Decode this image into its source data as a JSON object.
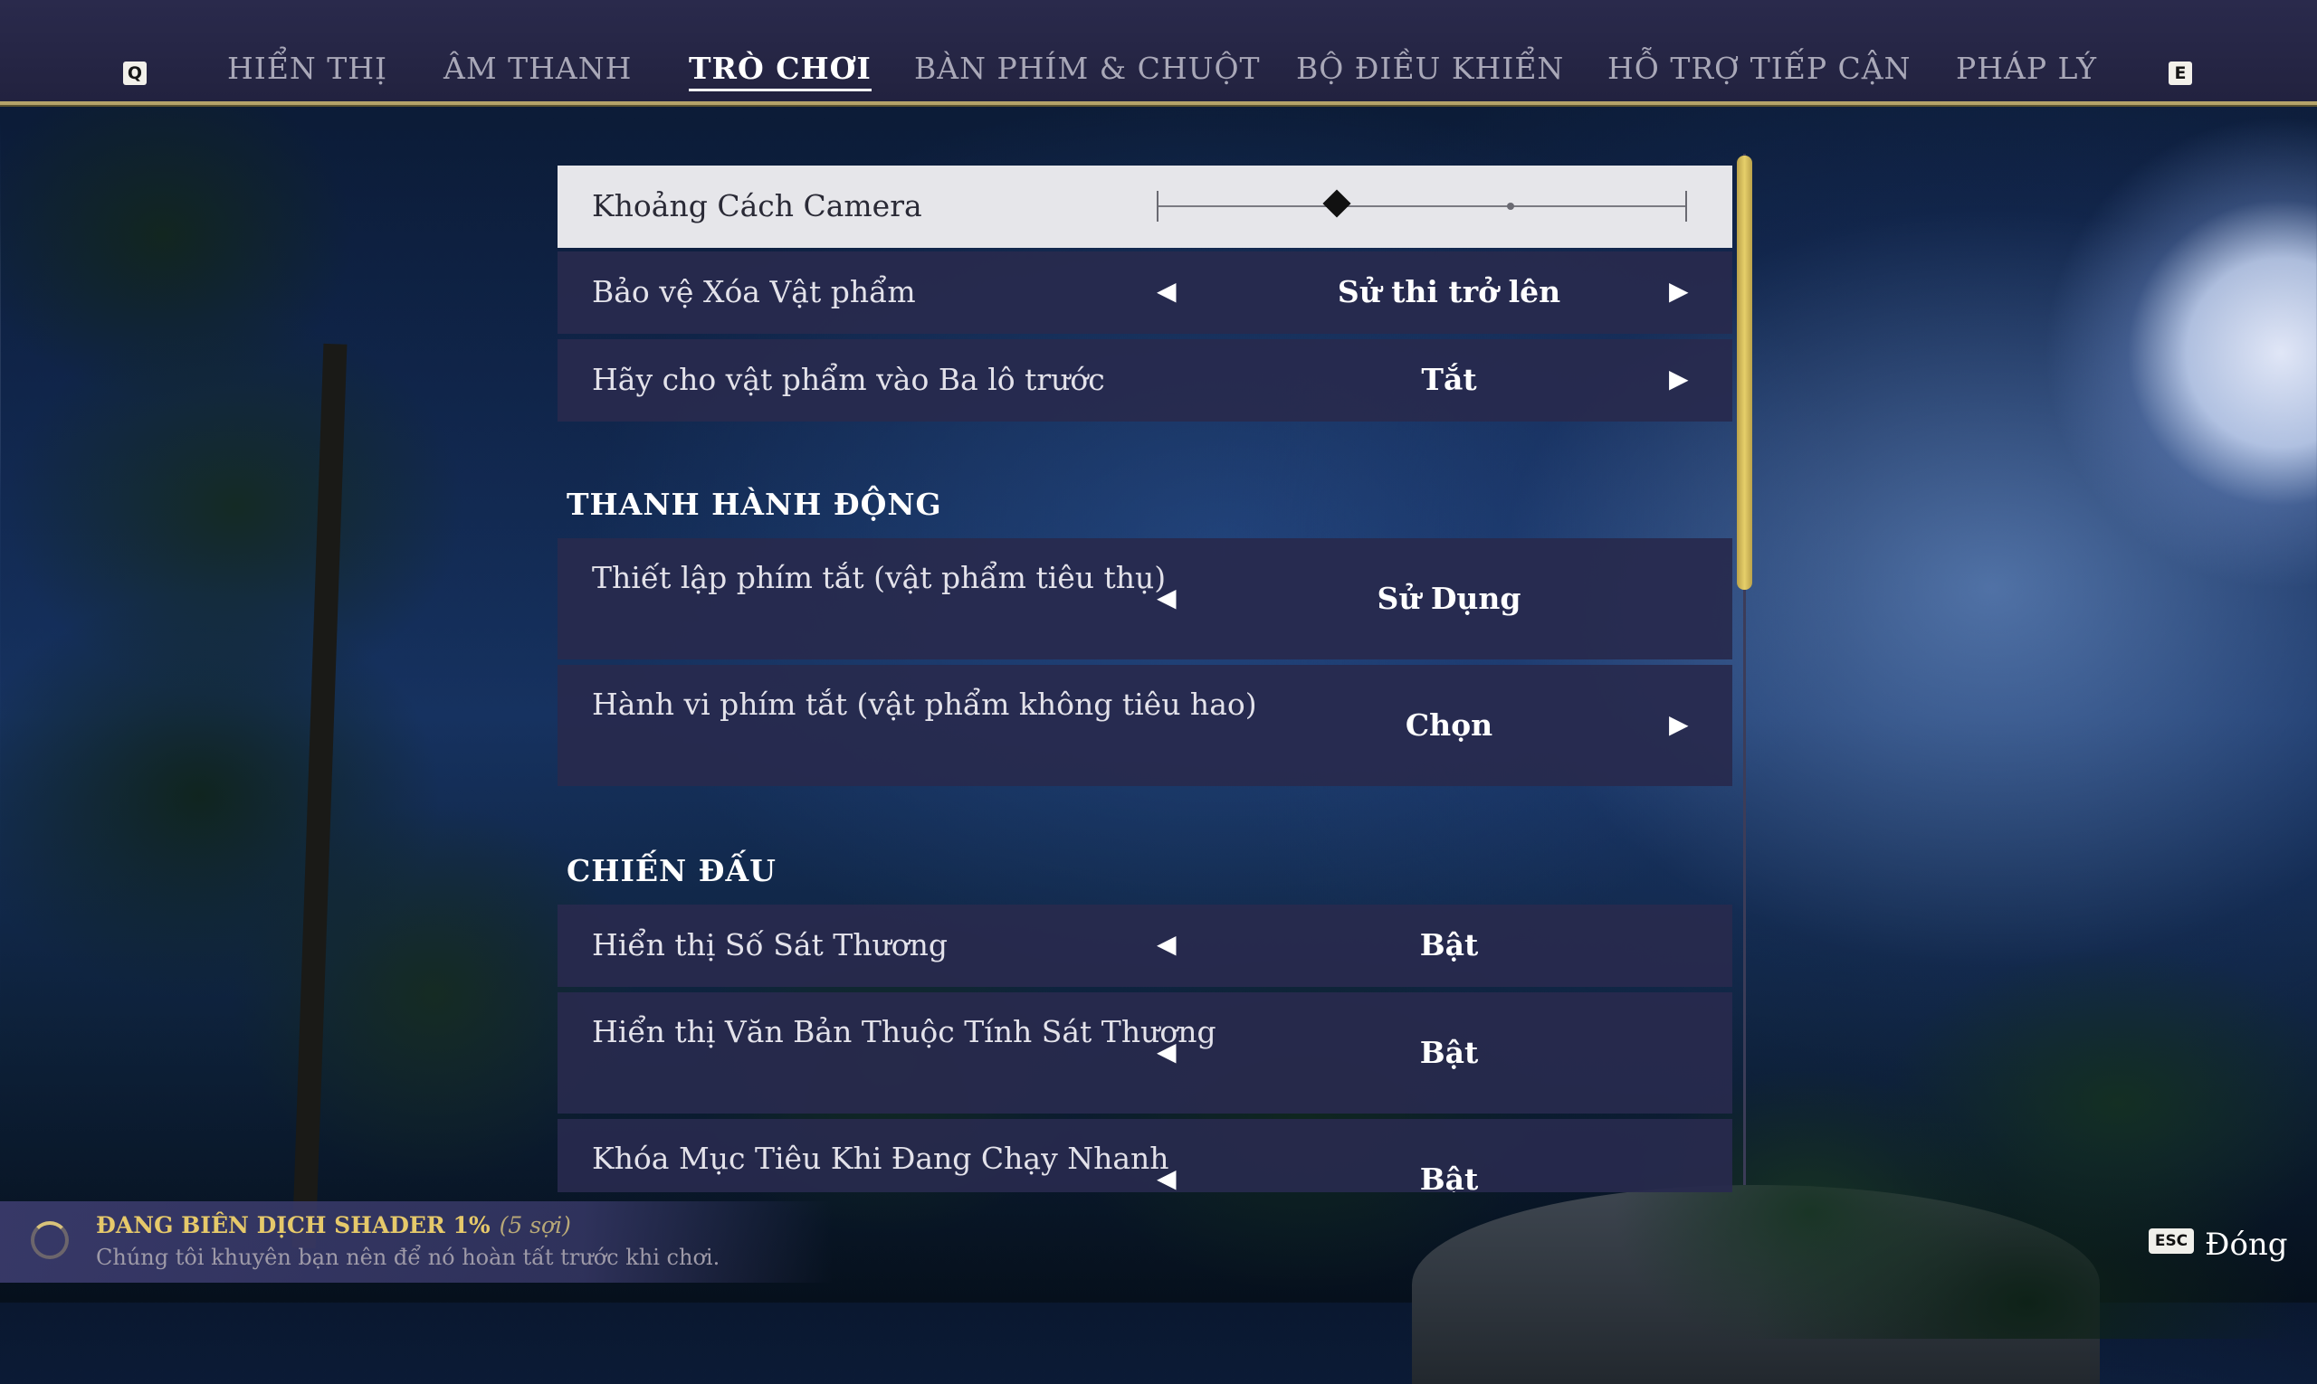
{
  "nav": {
    "left_key": "Q",
    "right_key": "E",
    "tabs": [
      {
        "label": "HIỂN THỊ",
        "active": false
      },
      {
        "label": "ÂM THANH",
        "active": false
      },
      {
        "label": "TRÒ CHƠI",
        "active": true
      },
      {
        "label": "BÀN PHÍM & CHUỘT",
        "active": false
      },
      {
        "label": "BỘ ĐIỀU KHIỂN",
        "active": false
      },
      {
        "label": "HỖ TRỢ TIẾP CẬN",
        "active": false
      },
      {
        "label": "PHÁP LÝ",
        "active": false
      }
    ]
  },
  "settings": {
    "camera_distance": {
      "label": "Khoảng Cách Camera",
      "level": 0.34
    },
    "item_salvage_protection": {
      "label": "Bảo vệ Xóa Vật phẩm",
      "value": "Sử thi trở lên"
    },
    "send_to_backpack": {
      "label": "Hãy cho vật phẩm vào Ba lô trước",
      "value": "Tắt"
    },
    "section_action_bar": "THANH HÀNH ĐỘNG",
    "shortcut_consumable": {
      "label": "Thiết lập phím tắt (vật phẩm tiêu thụ)",
      "value": "Sử Dụng"
    },
    "shortcut_nonconsumable": {
      "label": "Hành vi phím tắt (vật phẩm không tiêu hao)",
      "value": "Chọn"
    },
    "section_combat": "CHIẾN ĐẤU",
    "damage_numbers": {
      "label": "Hiển thị Số Sát Thương",
      "value": "Bật"
    },
    "damage_attribute_text": {
      "label": "Hiển thị Văn Bản Thuộc Tính Sát Thương",
      "value": "Bật"
    },
    "target_lock_running": {
      "label": "Khóa Mục Tiêu Khi Đang Chạy Nhanh",
      "value": "Bật"
    }
  },
  "status": {
    "title": "ĐANG BIÊN DỊCH SHADER 1%",
    "threads": "(5 sợi)",
    "message": "Chúng tôi khuyên bạn nên để nó hoàn tất trước khi chơi."
  },
  "close": {
    "key": "ESC",
    "label": "Đóng"
  },
  "colors": {
    "accent_gold": "#d8c27a",
    "row_bg": "#282a4e",
    "highlight_row": "#e6e6ea"
  }
}
